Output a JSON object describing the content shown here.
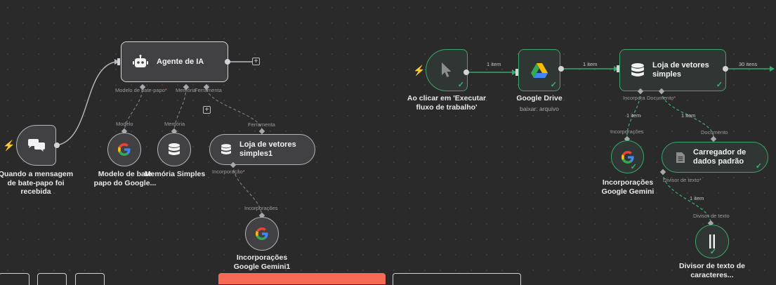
{
  "nodes": {
    "chat_trigger": {
      "title": "Quando a mensagem de bate-papo foi recebida"
    },
    "ai_agent": {
      "title": "Agente de IA"
    },
    "chat_model": {
      "title": "Modelo de bate papo do Google..."
    },
    "memory": {
      "title": "Memória Simples"
    },
    "vector_store_tool": {
      "title": "Loja de vetores simples1"
    },
    "embeddings_left": {
      "title": "Incorporações Google Gemini1"
    },
    "manual_trigger": {
      "title": "Ao clicar em 'Executar fluxo de trabalho'"
    },
    "google_drive": {
      "title": "Google Drive",
      "subtitle": "baixar: arquivo"
    },
    "vector_store": {
      "title": "Loja de vetores simples"
    },
    "embeddings_right": {
      "title": "Incorporações Google Gemini"
    },
    "data_loader": {
      "title": "Carregador de dados padrão"
    },
    "text_splitter": {
      "title": "Divisor de texto de caracteres..."
    }
  },
  "ports": {
    "agent_chat_model": "Modelo de bate-papo",
    "agent_memory": "Memória",
    "agent_tool": "Ferramenta",
    "chat_model_in": "Modelo",
    "memory_in": "Memória",
    "tool_in": "Ferramenta",
    "tool_embedding": "Incorporação",
    "embeddings_in_left": "Incorporações",
    "store_embedding": "Incorpora",
    "store_document": "Documento",
    "embeddings_in_right": "Incorporações",
    "loader_in": "Documento",
    "loader_splitter": "Divisor de texto",
    "splitter_in": "Divisor de texto",
    "required_mark": "*"
  },
  "edges": {
    "manual_to_drive": "1 item",
    "drive_to_store": "1 item",
    "store_out": "30 itens",
    "store_to_embeddings": "1 item",
    "store_to_loader": "1 item",
    "loader_to_splitter": "1 item"
  },
  "icons": {
    "trigger_bolt": "⚡",
    "checkmark": "✓",
    "plus": "+"
  },
  "colors": {
    "canvas": "#2a2a2b",
    "node_border": "#b4b4b6",
    "success": "#3aa76d",
    "trigger": "#ff6d5a",
    "google_blue": "#4285F4",
    "google_red": "#EA4335",
    "google_yellow": "#FBBC05",
    "google_green": "#34A853"
  }
}
